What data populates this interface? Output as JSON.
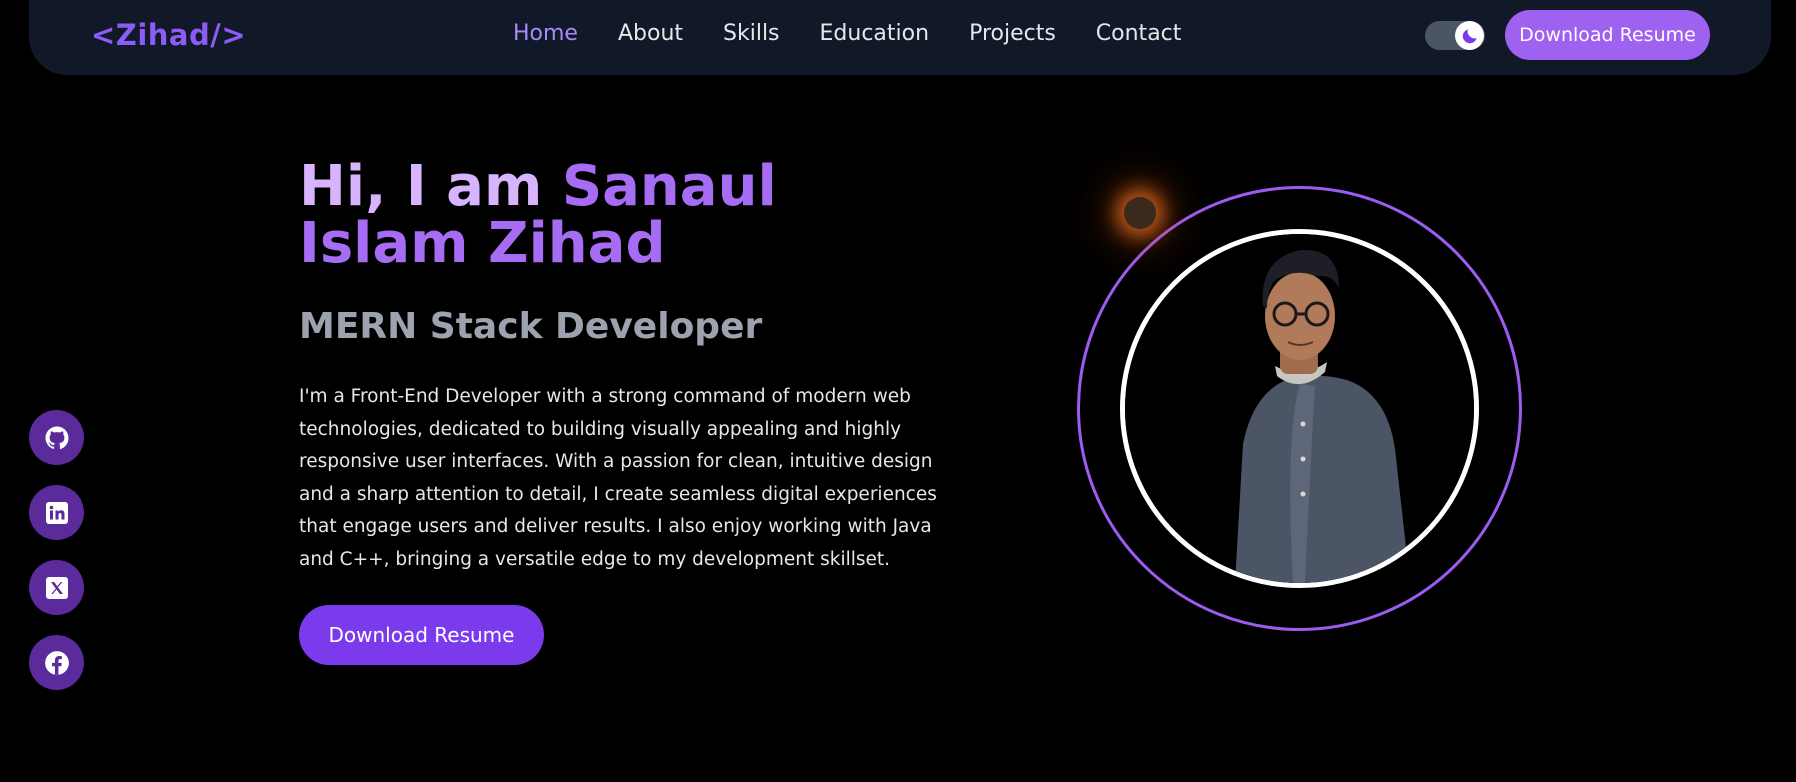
{
  "header": {
    "logo": "<Zihad/>",
    "nav": [
      "Home",
      "About",
      "Skills",
      "Education",
      "Projects",
      "Contact"
    ],
    "active_nav": "Home",
    "theme_toggle_icon": "moon-icon",
    "download_label": "Download Resume"
  },
  "hero": {
    "greeting": "Hi, I am ",
    "name": "Sanaul Islam Zihad",
    "subtitle": "MERN Stack Developer",
    "description": "I'm a Front-End Developer with a strong command of modern web technologies, dedicated to building visually appealing and highly responsive user interfaces. With a passion for clean, intuitive design and a sharp attention to detail, I create seamless digital experiences that engage users and deliver results. I also enjoy working with Java and C++, bringing a versatile edge to my development skillset.",
    "download_label": "Download Resume"
  },
  "social": [
    {
      "icon": "github-icon"
    },
    {
      "icon": "linkedin-icon"
    },
    {
      "icon": "x-twitter-icon"
    },
    {
      "icon": "facebook-icon"
    }
  ],
  "colors": {
    "accent": "#9f62f0",
    "accent_dark": "#7c3aed",
    "navbar_bg": "#111827",
    "background": "#000000",
    "glow": "#ea6e1e"
  }
}
